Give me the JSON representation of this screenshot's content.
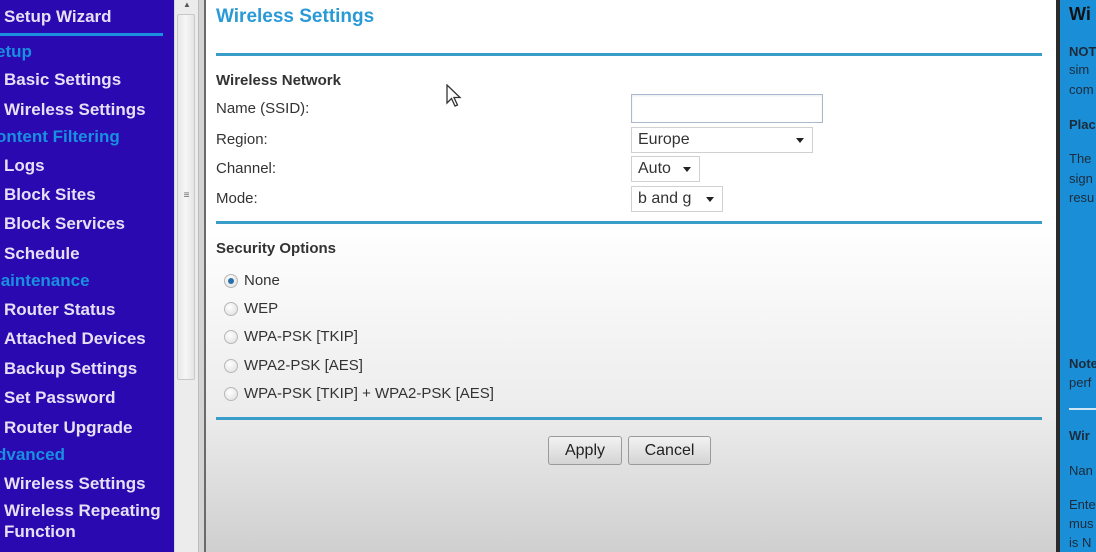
{
  "sidebar": {
    "wizard": "Setup Wizard",
    "sections": {
      "setup": "etup",
      "content_filtering": "ontent Filtering",
      "maintenance": "laintenance",
      "advanced": "dvanced"
    },
    "items": [
      {
        "label": "Basic Settings"
      },
      {
        "label": "Wireless Settings"
      },
      {
        "label": "Logs"
      },
      {
        "label": "Block Sites"
      },
      {
        "label": "Block Services"
      },
      {
        "label": "Schedule"
      },
      {
        "label": "Router Status"
      },
      {
        "label": "Attached Devices"
      },
      {
        "label": "Backup Settings"
      },
      {
        "label": "Set Password"
      },
      {
        "label": "Router Upgrade"
      },
      {
        "label": "Wireless Settings"
      },
      {
        "label": "Wireless Repeating"
      },
      {
        "label": "Function"
      }
    ]
  },
  "scrollbar": {
    "up_icon": "▲",
    "grip_icon": "≡"
  },
  "main": {
    "title": "Wireless Settings",
    "wireless_network": {
      "heading": "Wireless Network",
      "ssid_label": "Name (SSID):",
      "ssid_value": "",
      "region_label": "Region:",
      "region_value": "Europe",
      "channel_label": "Channel:",
      "channel_value": "Auto",
      "mode_label": "Mode:",
      "mode_value": "b and g"
    },
    "security": {
      "heading": "Security Options",
      "options": [
        {
          "label": "None",
          "checked": true
        },
        {
          "label": "WEP",
          "checked": false
        },
        {
          "label": "WPA-PSK [TKIP]",
          "checked": false
        },
        {
          "label": "WPA2-PSK [AES]",
          "checked": false
        },
        {
          "label": "WPA-PSK [TKIP] + WPA2-PSK [AES]",
          "checked": false
        }
      ]
    },
    "buttons": {
      "apply": "Apply",
      "cancel": "Cancel"
    }
  },
  "help": {
    "title": "Wi",
    "lines": [
      "NOT",
      "sim",
      "com",
      "Plac",
      "The",
      "sign",
      "resu",
      "Note",
      "perf",
      "Wir",
      "Nan",
      "Ente",
      "mus",
      "is N"
    ]
  }
}
